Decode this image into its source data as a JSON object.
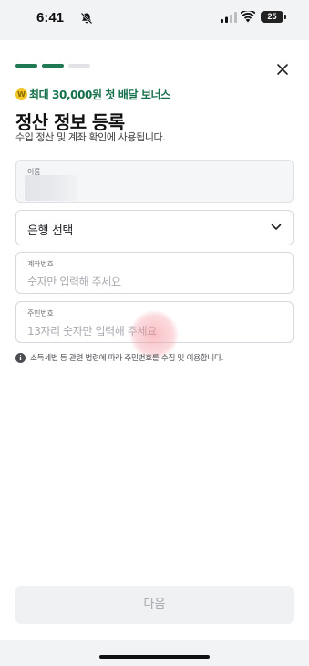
{
  "status_bar": {
    "time": "6:41",
    "battery": "25",
    "icons": [
      "bell-slash-icon",
      "cellular-signal-icon",
      "wifi-icon",
      "battery-icon"
    ]
  },
  "progress": {
    "total_steps": 3,
    "completed_steps": 2,
    "active_color": "#1f7a53",
    "inactive_color": "#e1e3e6"
  },
  "header": {
    "close_icon": "close-icon",
    "promo_icon": "coin-icon",
    "promo_coin": "W",
    "promo_text": "최대 30,000원 첫 배달 보너스",
    "title": "정산 정보 등록",
    "subtitle": "수입 정산 및 계좌 확인에 사용됩니다."
  },
  "form": {
    "name": {
      "label": "이름",
      "value": ""
    },
    "bank": {
      "value": "은행 선택",
      "icon": "chevron-down-icon"
    },
    "account": {
      "label": "계좌번호",
      "placeholder": "숫자만 입력해 주세요"
    },
    "resident": {
      "label": "주민번호",
      "placeholder": "13자리 숫자만 입력해 주세요"
    }
  },
  "notice": {
    "icon": "info-icon",
    "text": "소득세법 등 관련 법령에 따라 주민번호를 수집 및 이용합니다."
  },
  "footer": {
    "next_label": "다음"
  },
  "colors": {
    "brand_green": "#14704a",
    "coin": "#f3c623"
  }
}
